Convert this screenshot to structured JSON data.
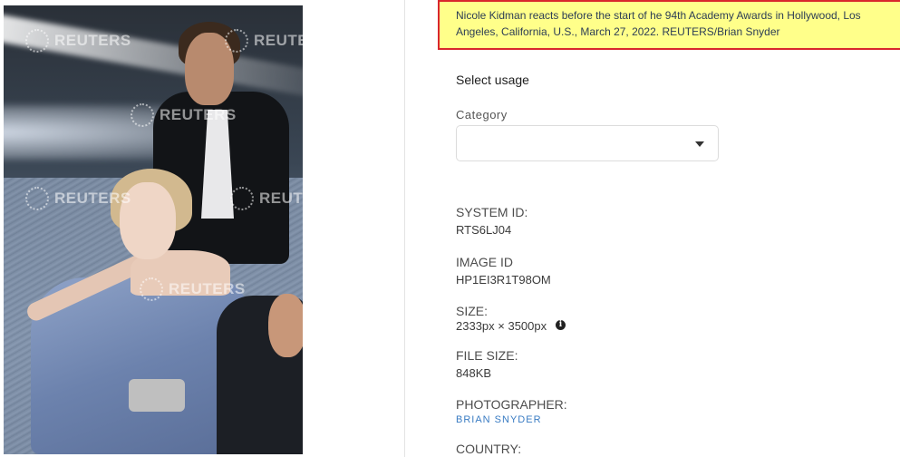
{
  "photo": {
    "watermark": "REUTERS"
  },
  "caption": "Nicole Kidman reacts before the start of he 94th Academy Awards in Hollywood, Los Angeles, California, U.S., March 27, 2022. REUTERS/Brian Snyder",
  "usage": {
    "title": "Select usage",
    "category_label": "Category",
    "category_value": ""
  },
  "meta": {
    "system_id_label": "SYSTEM ID:",
    "system_id": "RTS6LJ04",
    "image_id_label": "IMAGE ID",
    "image_id": "HP1EI3R1T98OM",
    "size_label": "SIZE:",
    "size": "2333px × 3500px",
    "info_icon": "info-icon",
    "file_size_label": "FILE SIZE:",
    "file_size": "848KB",
    "photographer_label": "PHOTOGRAPHER:",
    "photographer": "BRIAN SNYDER",
    "country_label": "COUNTRY:"
  },
  "colors": {
    "caption_highlight": "#ffff8a",
    "caption_border": "#d9262c",
    "link": "#3a7cc3"
  }
}
